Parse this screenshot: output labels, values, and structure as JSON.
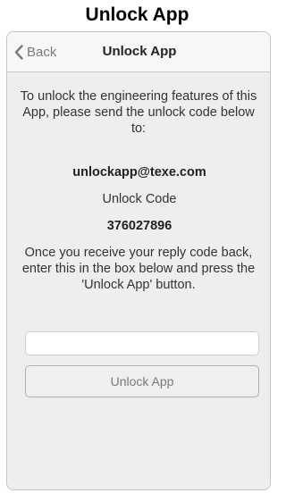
{
  "caption": "Unlock App",
  "navbar": {
    "back_label": "Back",
    "back_icon": "chevron-left-icon",
    "title": "Unlock App"
  },
  "content": {
    "instructions": "To unlock the engineering features of this App, please send the unlock code below to:",
    "email": "unlockapp@texe.com",
    "code_label": "Unlock Code",
    "code_value": "376027896",
    "reply_instructions": "Once you receive your reply code back, enter this in the box below and press the 'Unlock App' button.",
    "reply_code_input": {
      "value": "",
      "placeholder": ""
    },
    "unlock_button_label": "Unlock App"
  },
  "colors": {
    "background": "#eeeeee",
    "navbar": "#f7f7f7",
    "muted_text": "#7a7a7a"
  }
}
